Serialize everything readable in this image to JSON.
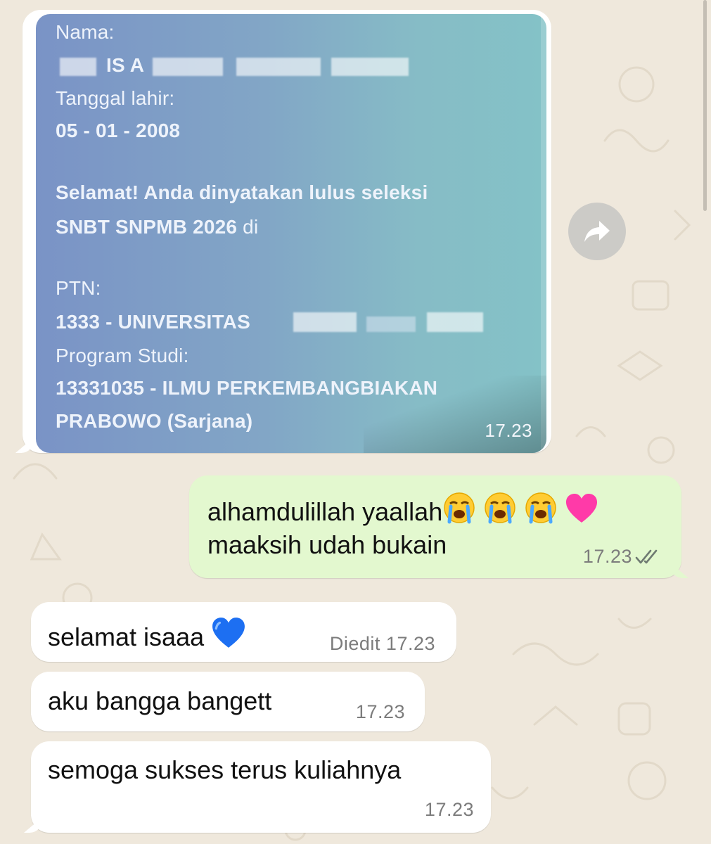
{
  "chat": {
    "image_message": {
      "lines": {
        "nama_label": "Nama:",
        "nama_value": "IS A",
        "tanggal_label": "Tanggal lahir:",
        "tanggal_value": "05 - 01 - 2008",
        "congrats_line1": "Selamat! Anda dinyatakan lulus seleksi",
        "congrats_line2": "SNBT SNPMB 2026",
        "congrats_line2_suffix": " di",
        "ptn_label": "PTN:",
        "ptn_value": "1333 - UNIVERSITAS",
        "prodi_label": "Program Studi:",
        "prodi_value1": "13331035 - ILMU PERKEMBANGBIAKAN",
        "prodi_value2": "PRABOWO (Sarjana)"
      },
      "time": "17.23"
    },
    "outgoing_message": {
      "line1": "alhamdulillah yaallah",
      "line2": "maaksih udah bukain",
      "time": "17.23",
      "status_icon": "double-check-icon"
    },
    "incoming_messages": [
      {
        "text": "selamat isaaa",
        "edited_label": "Diedit",
        "time": "17.23"
      },
      {
        "text": "aku bangga bangett",
        "time": "17.23"
      },
      {
        "text": "semoga sukses terus kuliahnya",
        "time": "17.23"
      }
    ],
    "icons": {
      "forward": "forward-arrow-icon",
      "crying": "loudly-crying-face-icon",
      "pink_heart": "pink-heart-icon",
      "blue_heart": "blue-heart-icon"
    },
    "colors": {
      "chat_background": "#efe8dc",
      "outgoing_bubble": "#e3f8cf",
      "incoming_bubble": "#ffffff",
      "read_tick": "#6f7a72"
    }
  }
}
